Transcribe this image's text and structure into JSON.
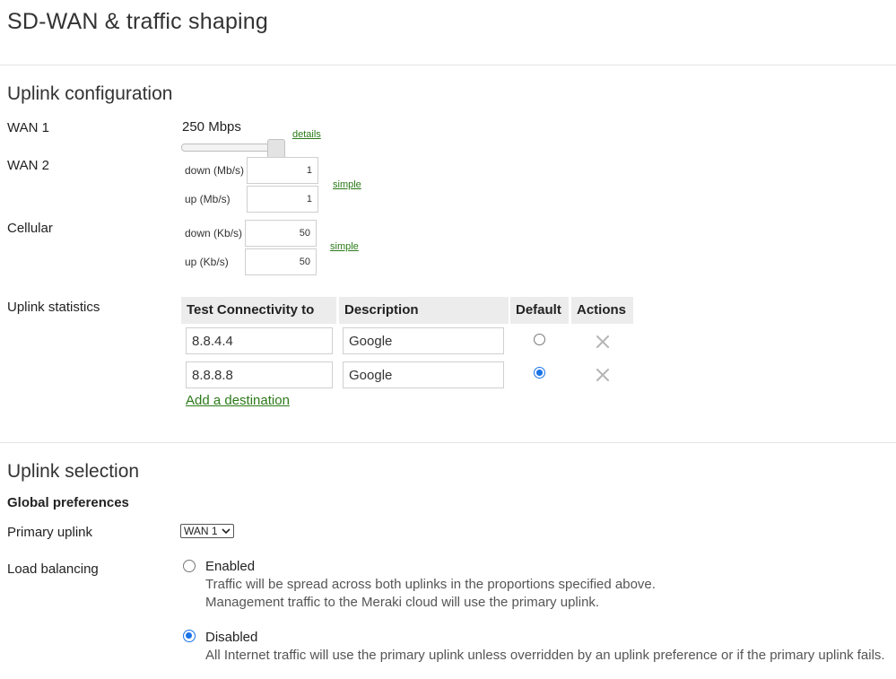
{
  "page": {
    "title": "SD-WAN & traffic shaping"
  },
  "uplink_config": {
    "heading": "Uplink configuration",
    "wan1": {
      "label": "WAN 1",
      "bandwidth_text": "250 Mbps",
      "details_link": "details",
      "slider_level": 0.91
    },
    "wan2": {
      "label": "WAN 2",
      "down_label": "down (Mb/s)",
      "down_value": "1",
      "up_label": "up (Mb/s)",
      "up_value": "1",
      "simple_link": "simple"
    },
    "cellular": {
      "label": "Cellular",
      "down_label": "down (Kb/s)",
      "down_value": "50",
      "up_label": "up (Kb/s)",
      "up_value": "50",
      "simple_link": "simple"
    }
  },
  "uplink_statistics": {
    "label": "Uplink statistics",
    "columns": [
      "Test Connectivity to",
      "Description",
      "Default",
      "Actions"
    ],
    "rows": [
      {
        "destination": "8.8.4.4",
        "description": "Google",
        "default": false,
        "action_icon": "close-icon"
      },
      {
        "destination": "8.8.8.8",
        "description": "Google",
        "default": true,
        "action_icon": "close-icon"
      }
    ],
    "add_link": "Add a destination"
  },
  "uplink_selection": {
    "heading": "Uplink selection",
    "subheading": "Global preferences",
    "primary_uplink": {
      "label": "Primary uplink",
      "selected": "WAN 1"
    },
    "load_balancing": {
      "label": "Load balancing",
      "enabled": {
        "label": "Enabled",
        "selected": false,
        "desc_line1": "Traffic will be spread across both uplinks in the proportions specified above.",
        "desc_line2": "Management traffic to the Meraki cloud will use the primary uplink."
      },
      "disabled": {
        "label": "Disabled",
        "selected": true,
        "desc_line1": "All Internet traffic will use the primary uplink unless overridden by an uplink preference or if the primary uplink fails."
      }
    }
  },
  "colors": {
    "link": "#2b7a18",
    "radio_accent": "#1a73e8",
    "header_bg": "#ececec",
    "x_icon": "#b5b5b5"
  }
}
